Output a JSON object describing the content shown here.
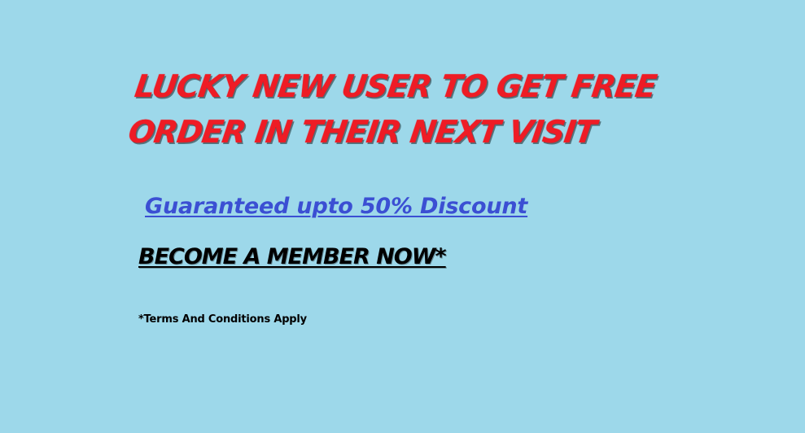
{
  "promo": {
    "headline": "LUCKY NEW USER TO GET FREE ORDER IN THEIR NEXT VISIT",
    "discount_text": "Guaranteed upto 50% Discount",
    "member_cta": "BECOME A MEMBER NOW*",
    "terms_text": "*Terms And Conditions Apply",
    "colors": {
      "background": "#9dd8ea",
      "headline": "#ee1c25",
      "discount": "#3b4fd3",
      "cta": "#000000"
    }
  }
}
